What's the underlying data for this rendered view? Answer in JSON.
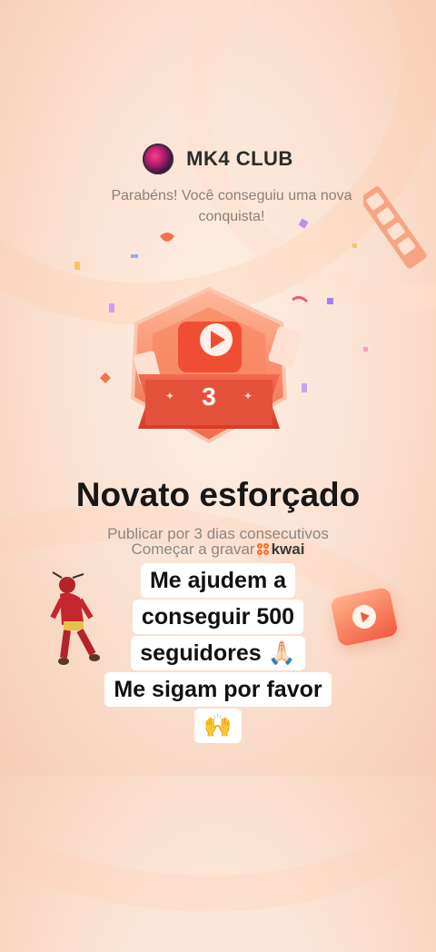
{
  "header": {
    "club_name": "MK4 CLUB",
    "avatar_icon": "club-avatar"
  },
  "message": {
    "congrats": "Parabéns! Você conseguiu uma nova conquista!"
  },
  "badge": {
    "level": "3",
    "icon": "video-play-icon"
  },
  "achievement": {
    "title": "Novato esforçado",
    "description": "Publicar por 3 dias consecutivos",
    "record_label": "Começar a gravar",
    "brand": "kwai"
  },
  "overlay": {
    "lines": [
      "Me ajudem a",
      "conseguir 500",
      "seguidores 🙏🏻",
      "Me sigam por favor",
      "🙌"
    ]
  },
  "colors": {
    "accent": "#e9503a",
    "badge_light": "#ffb199",
    "background": "#fbe3d4"
  }
}
